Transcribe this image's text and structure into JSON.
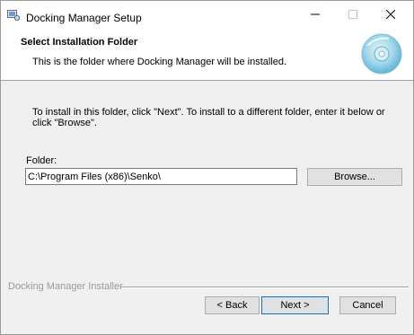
{
  "window": {
    "title": "Docking Manager Setup",
    "controls": {
      "minimize": "—",
      "maximize": "☐",
      "close": "✕"
    }
  },
  "header": {
    "title": "Select Installation Folder",
    "description": "This is the folder where Docking Manager will be installed."
  },
  "main": {
    "instruction": "To install in this folder, click \"Next\". To install to a different folder, enter it below or click \"Browse\".",
    "folder_label": "Folder:",
    "folder_value": "C:\\Program Files (x86)\\Senko\\",
    "browse_label": "Browse..."
  },
  "footer": {
    "installer_label": "Docking Manager Installer",
    "back_label": "< Back",
    "next_label": "Next >",
    "cancel_label": "Cancel"
  },
  "icons": {
    "app": "setup-app-icon",
    "header": "cd-disc-icon"
  },
  "colors": {
    "header_bg": "#ffffff",
    "body_bg": "#f0f0f0",
    "default_button_border": "#0078d7",
    "disabled_text": "#9a9a9a"
  }
}
